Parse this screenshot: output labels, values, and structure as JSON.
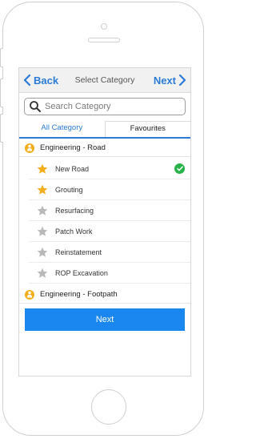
{
  "navbar": {
    "back_label": "Back",
    "title": "Select Category",
    "next_label": "Next"
  },
  "search": {
    "placeholder": "Search Category",
    "value": ""
  },
  "tabs": [
    {
      "label": "All Category",
      "active": true
    },
    {
      "label": "Favourites",
      "active": false
    }
  ],
  "groups": [
    {
      "label": "Engineering - Road",
      "items": [
        {
          "label": "New Road",
          "favourite": true,
          "selected": true
        },
        {
          "label": "Grouting",
          "favourite": true,
          "selected": false
        },
        {
          "label": "Resurfacing",
          "favourite": false,
          "selected": false
        },
        {
          "label": "Patch Work",
          "favourite": false,
          "selected": false
        },
        {
          "label": "Reinstatement",
          "favourite": false,
          "selected": false
        },
        {
          "label": "ROP Excavation",
          "favourite": false,
          "selected": false
        }
      ]
    },
    {
      "label": "Engineering - Footpath",
      "items": []
    }
  ],
  "primary_button": {
    "label": "Next"
  },
  "colors": {
    "accent": "#2a7bd6",
    "button": "#1a86f0",
    "star_active": "#f4ad1b",
    "star_inactive": "#b9b9b9",
    "check": "#2bb34b"
  }
}
